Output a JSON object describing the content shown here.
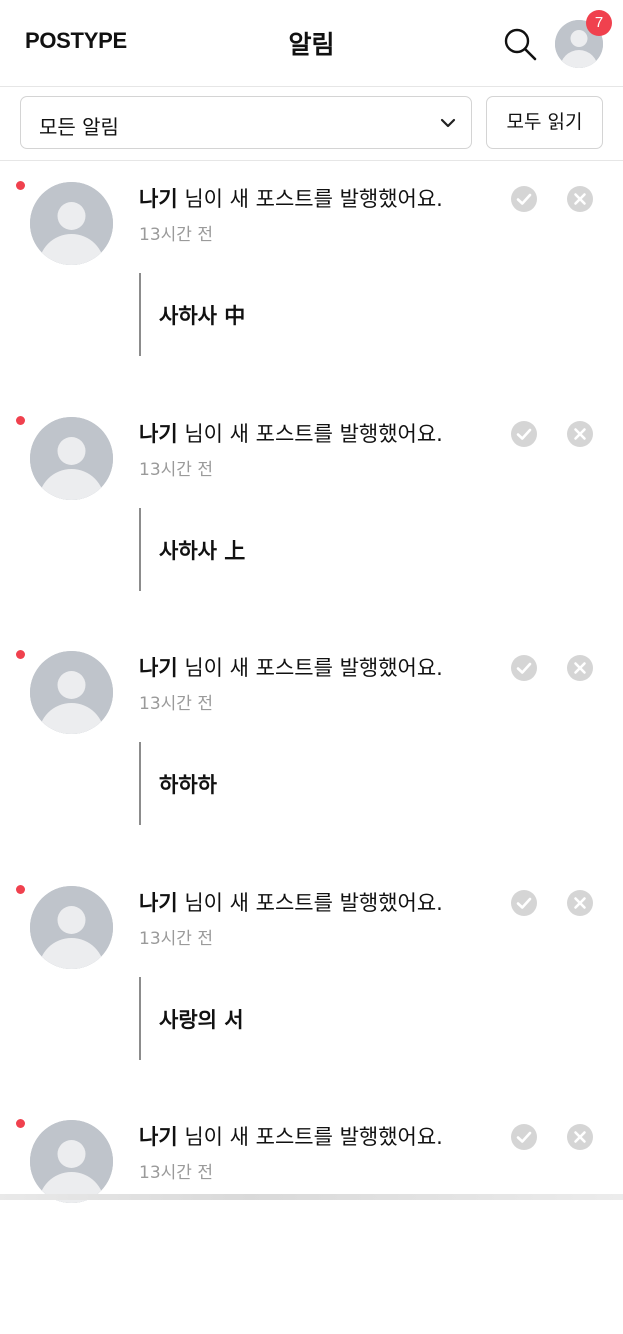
{
  "header": {
    "logo": "POSTYPE",
    "title": "알림",
    "search_icon": "search-icon",
    "profile_badge_count": "7",
    "badge_color": "#f0414e"
  },
  "filter": {
    "selected": "모든 알림",
    "read_all_label": "모두 읽기"
  },
  "notifications": [
    {
      "name": "나기",
      "message": " 님이 새 포스트를 발행했어요.",
      "time": "13시간 전",
      "post_title": "사하사 中",
      "unread": true
    },
    {
      "name": "나기",
      "message": " 님이 새 포스트를 발행했어요.",
      "time": "13시간 전",
      "post_title": "사하사 上",
      "unread": true
    },
    {
      "name": "나기",
      "message": " 님이 새 포스트를 발행했어요.",
      "time": "13시간 전",
      "post_title": "하하하",
      "unread": true
    },
    {
      "name": "나기",
      "message": " 님이 새 포스트를 발행했어요.",
      "time": "13시간 전",
      "post_title": "사랑의 서",
      "unread": true
    },
    {
      "name": "나기",
      "message": " 님이 새 포스트를 발행했어요.",
      "time": "13시간 전",
      "post_title": "",
      "unread": true
    }
  ],
  "colors": {
    "unread_dot": "#f0414e",
    "avatar_bg": "#bfc4cb",
    "action_icon": "#d5d5d5",
    "muted_text": "#9a9a9a"
  }
}
